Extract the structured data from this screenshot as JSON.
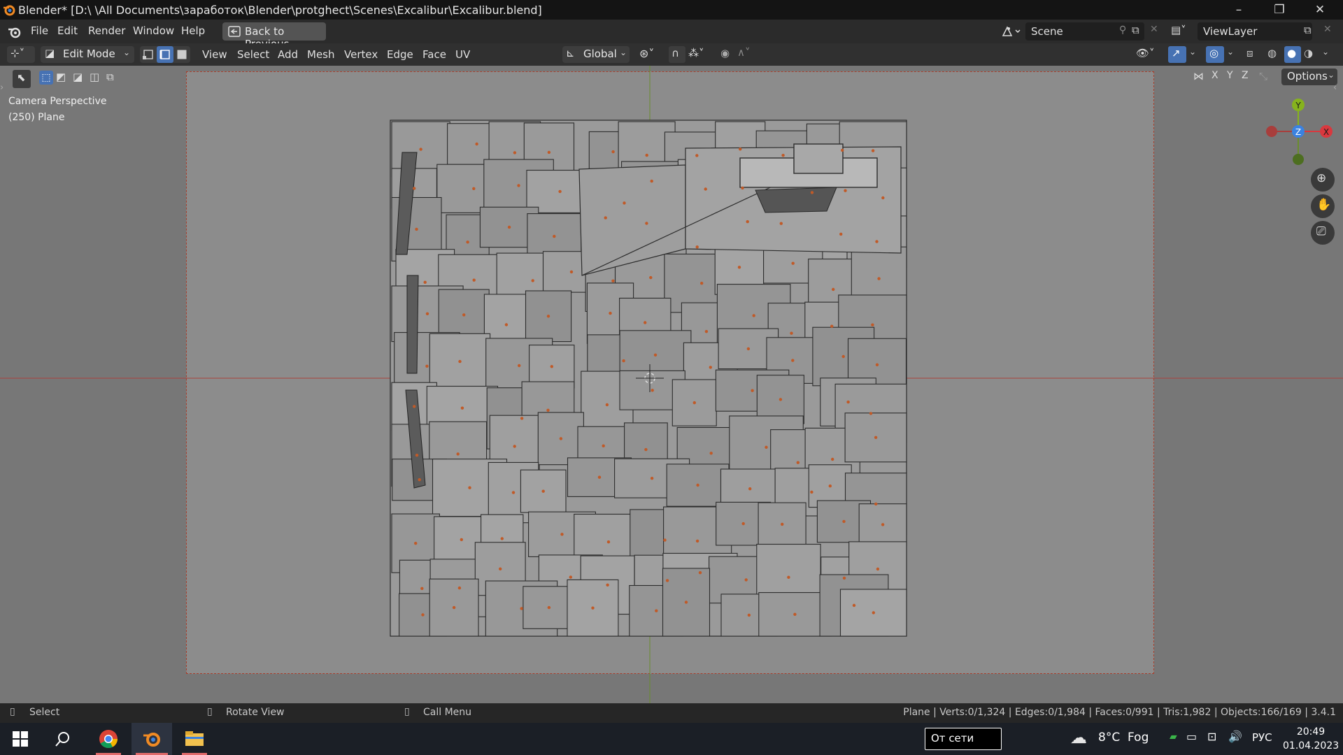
{
  "window": {
    "title": "Blender* [D:\\ \\All Documents\\заработок\\Blender\\protghect\\Scenes\\Excalibur\\Excalibur.blend]",
    "minimize": "–",
    "maximize": "❐",
    "close": "✕"
  },
  "menu": {
    "items": [
      "File",
      "Edit",
      "Render",
      "Window",
      "Help"
    ],
    "back_button": "Back to Previous",
    "scene": "Scene",
    "view_layer": "ViewLayer"
  },
  "header": {
    "mode": "Edit Mode",
    "menus": [
      "View",
      "Select",
      "Add",
      "Mesh",
      "Vertex",
      "Edge",
      "Face",
      "UV"
    ],
    "transform_orientation": "Global",
    "options": "Options",
    "axes": [
      "X",
      "Y",
      "Z"
    ]
  },
  "viewport": {
    "view_name": "Camera Perspective",
    "object_label": "(250) Plane",
    "gizmo": {
      "x": "X",
      "y": "Y",
      "z": "Z"
    }
  },
  "statusbar": {
    "select": "Select",
    "rotate": "Rotate View",
    "call_menu": "Call Menu",
    "stats": "Plane | Verts:0/1,324 | Edges:0/1,984 | Faces:0/991 | Tris:1,982 | Objects:166/169 | 3.4.1"
  },
  "taskbar": {
    "network": "От сети",
    "weather": "8°C  Fog",
    "language": "РУС",
    "time": "20:49",
    "date": "01.04.2023"
  },
  "colors": {
    "accent": "#4772b3",
    "axis_x": "#d9383e",
    "axis_y": "#86b31d",
    "axis_z": "#3b82e0",
    "vertex": "#c05a28"
  }
}
